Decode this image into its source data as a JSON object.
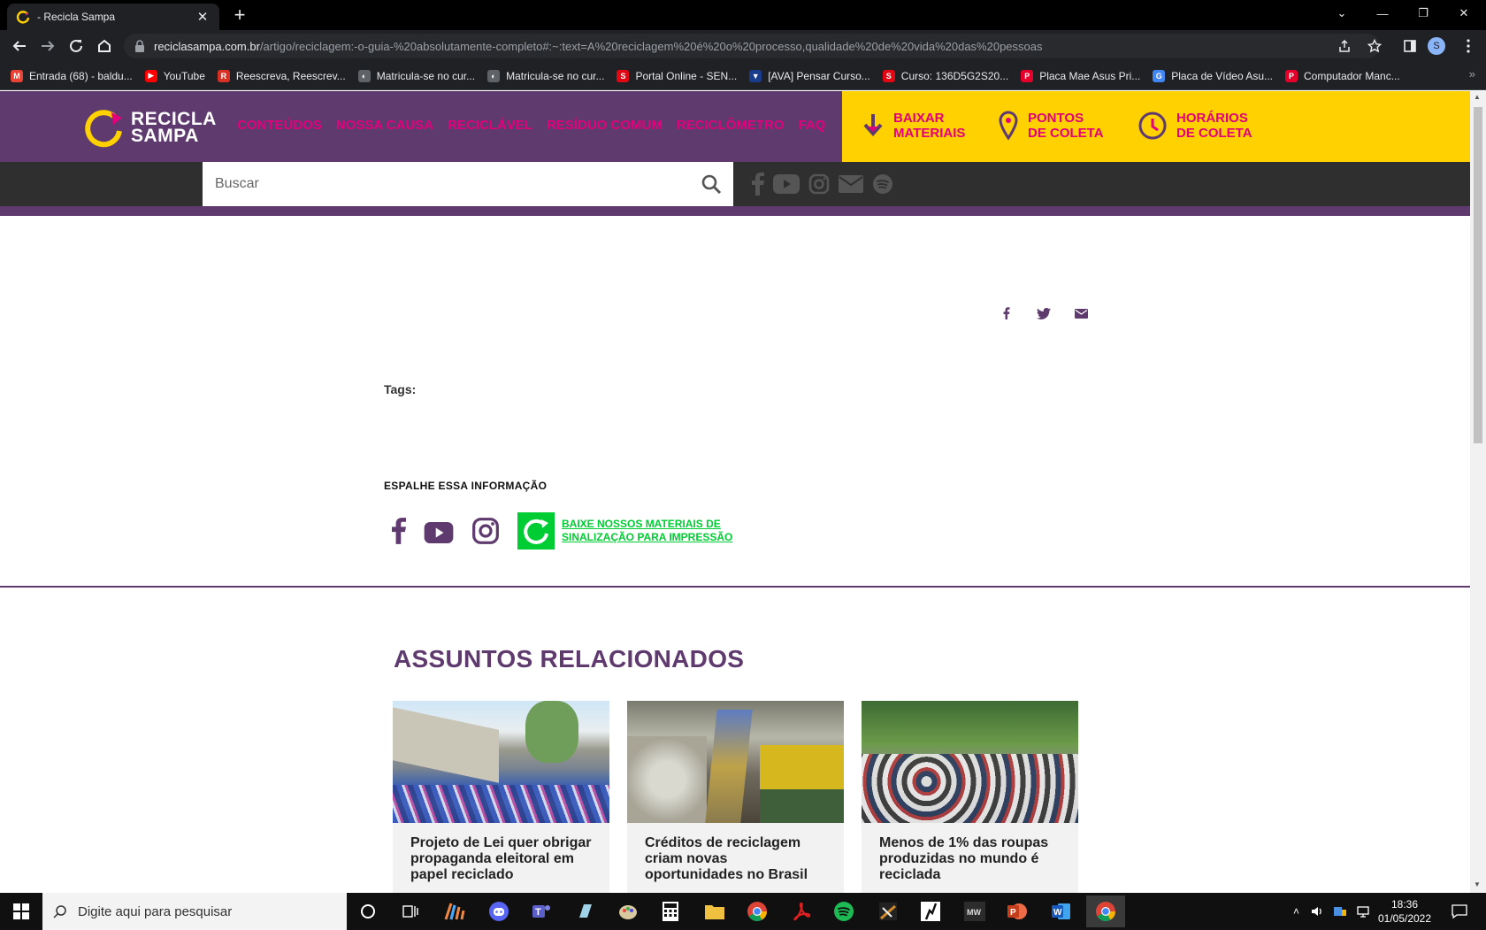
{
  "browser": {
    "tab_title": "- Recicla Sampa",
    "url_host": "reciclasampa.com.br",
    "url_path": "/artigo/reciclagem:-o-guia-%20absolutamente-completo#:~:text=A%20reciclagem%20é%20o%20processo,qualidade%20de%20vida%20das%20pessoas",
    "profile_initial": "S",
    "bookmarks": [
      {
        "label": "Entrada (68) - baldu...",
        "icon_color": "#ea4335",
        "icon_glyph": "M"
      },
      {
        "label": "YouTube",
        "icon_color": "#ff0000",
        "icon_glyph": "▶"
      },
      {
        "label": "Reescreva, Reescrev...",
        "icon_color": "#d93025",
        "icon_glyph": "R"
      },
      {
        "label": "Matricula-se no cur...",
        "icon_color": "#5f6368",
        "icon_glyph": "◐"
      },
      {
        "label": "Matricula-se no cur...",
        "icon_color": "#5f6368",
        "icon_glyph": "◐"
      },
      {
        "label": "Portal Online - SEN...",
        "icon_color": "#e30613",
        "icon_glyph": "S"
      },
      {
        "label": "[AVA] Pensar Curso...",
        "icon_color": "#1a3c8c",
        "icon_glyph": "▼"
      },
      {
        "label": "Curso: 136D5G2S20...",
        "icon_color": "#e30613",
        "icon_glyph": "S"
      },
      {
        "label": "Placa Mae Asus Pri...",
        "icon_color": "#e4002b",
        "icon_glyph": "P"
      },
      {
        "label": "Placa de Vídeo Asu...",
        "icon_color": "#4285f4",
        "icon_glyph": "G"
      },
      {
        "label": "Computador Manc...",
        "icon_color": "#e4002b",
        "icon_glyph": "P"
      }
    ],
    "bookmarks_more": "»"
  },
  "site": {
    "logo_line1": "RECICLA",
    "logo_line2": "SAMPA",
    "nav": [
      "CONTEÚDOS",
      "NOSSA CAUSA",
      "RECICLÁVEL",
      "RESÍDUO COMUM",
      "RECICLÔMETRO",
      "FAQ"
    ],
    "yellow_links": [
      {
        "line1": "BAIXAR",
        "line2": "MATERIAIS"
      },
      {
        "line1": "PONTOS",
        "line2": "DE COLETA"
      },
      {
        "line1": "HORÁRIOS",
        "line2": "DE COLETA"
      }
    ],
    "search_placeholder": "Buscar",
    "colors": {
      "purple": "#5e3a6e",
      "yellow": "#ffd100",
      "pink": "#e4007c",
      "green": "#00cc33"
    }
  },
  "article": {
    "tags_label": "Tags:",
    "spread_title": "ESPALHE ESSA INFORMAÇÃO",
    "download_link": "BAIXE NOSSOS MATERIAIS DE SINALIZAÇÃO PARA IMPRESSÃO"
  },
  "related": {
    "title": "ASSUNTOS RELACIONADOS",
    "cards": [
      {
        "title": "Projeto de Lei quer obrigar propaganda eleitoral em papel reciclado"
      },
      {
        "title": "Créditos de reciclagem criam novas oportunidades no Brasil"
      },
      {
        "title": "Menos de 1% das roupas produzidas no mundo é reciclada"
      }
    ]
  },
  "taskbar": {
    "search_placeholder": "Digite aqui para pesquisar",
    "time": "18:36",
    "date": "01/05/2022"
  }
}
